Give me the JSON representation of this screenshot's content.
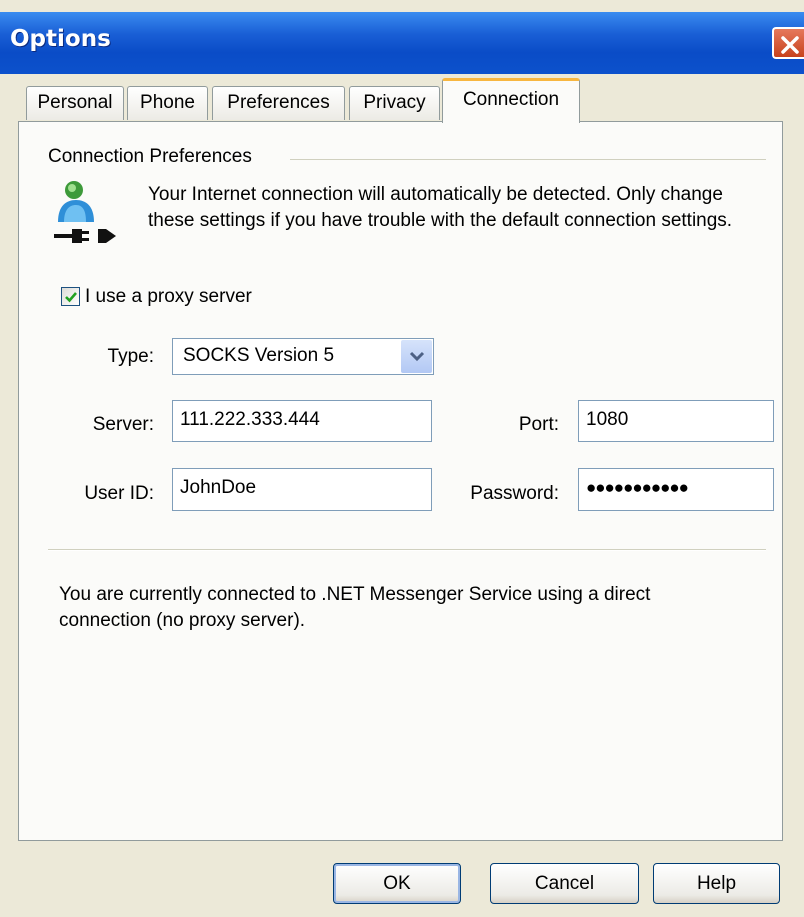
{
  "window": {
    "title": "Options"
  },
  "tabs": [
    {
      "label": "Personal",
      "active": false
    },
    {
      "label": "Phone",
      "active": false
    },
    {
      "label": "Preferences",
      "active": false
    },
    {
      "label": "Privacy",
      "active": false
    },
    {
      "label": "Connection",
      "active": true
    }
  ],
  "connection": {
    "group_label": "Connection Preferences",
    "info_text": "Your Internet connection will automatically be detected.  Only change these settings if you have trouble with the default connection settings.",
    "proxy_checkbox": {
      "label": "I use a proxy server",
      "checked": true
    },
    "type": {
      "label": "Type:",
      "value": "SOCKS Version 5"
    },
    "server": {
      "label": "Server:",
      "value": "111.222.333.444"
    },
    "port": {
      "label": "Port:",
      "value": "1080"
    },
    "user_id": {
      "label": "User ID:",
      "value": "JohnDoe"
    },
    "password": {
      "label": "Password:",
      "value": "●●●●●●●●●●●"
    },
    "status_text": "You are currently connected to .NET Messenger Service using a direct connection (no proxy server)."
  },
  "buttons": {
    "ok": "OK",
    "cancel": "Cancel",
    "help": "Help"
  },
  "colors": {
    "titlebar": "#0a4cc7",
    "dialog_bg": "#ece9d8",
    "active_tab_accent": "#f7b640",
    "check_green": "#21a121",
    "close_red": "#c7421d"
  },
  "icons": {
    "connection": "user-network-plug-icon",
    "close": "close-icon",
    "dropdown": "chevron-down-icon",
    "check": "checkmark-icon"
  }
}
